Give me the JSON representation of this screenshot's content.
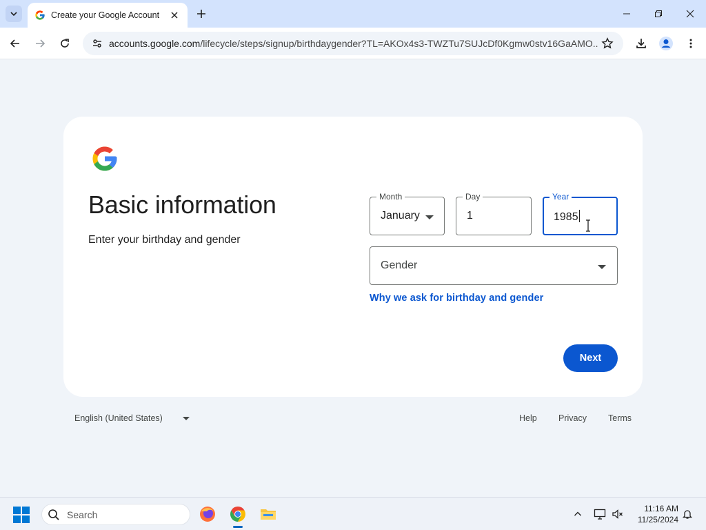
{
  "browser": {
    "tab_title": "Create your Google Account",
    "url_domain": "accounts.google.com",
    "url_path": "/lifecycle/steps/signup/birthdaygender?TL=AKOx4s3-TWZTu7SUJcDf0Kgmw0stv16GaAMO..."
  },
  "page": {
    "title": "Basic information",
    "subtitle": "Enter your birthday and gender",
    "month": {
      "label": "Month",
      "value": "January"
    },
    "day": {
      "label": "Day",
      "value": "1"
    },
    "year": {
      "label": "Year",
      "value": "1985"
    },
    "gender": {
      "placeholder": "Gender"
    },
    "why_link": "Why we ask for birthday and gender",
    "next_label": "Next"
  },
  "footer": {
    "language": "English (United States)",
    "help": "Help",
    "privacy": "Privacy",
    "terms": "Terms"
  },
  "taskbar": {
    "search_placeholder": "Search",
    "time": "11:16 AM",
    "date": "11/25/2024"
  },
  "colors": {
    "primary": "#0b57d0",
    "page_bg": "#f0f4f9",
    "tabbar_bg": "#d3e3fd"
  }
}
